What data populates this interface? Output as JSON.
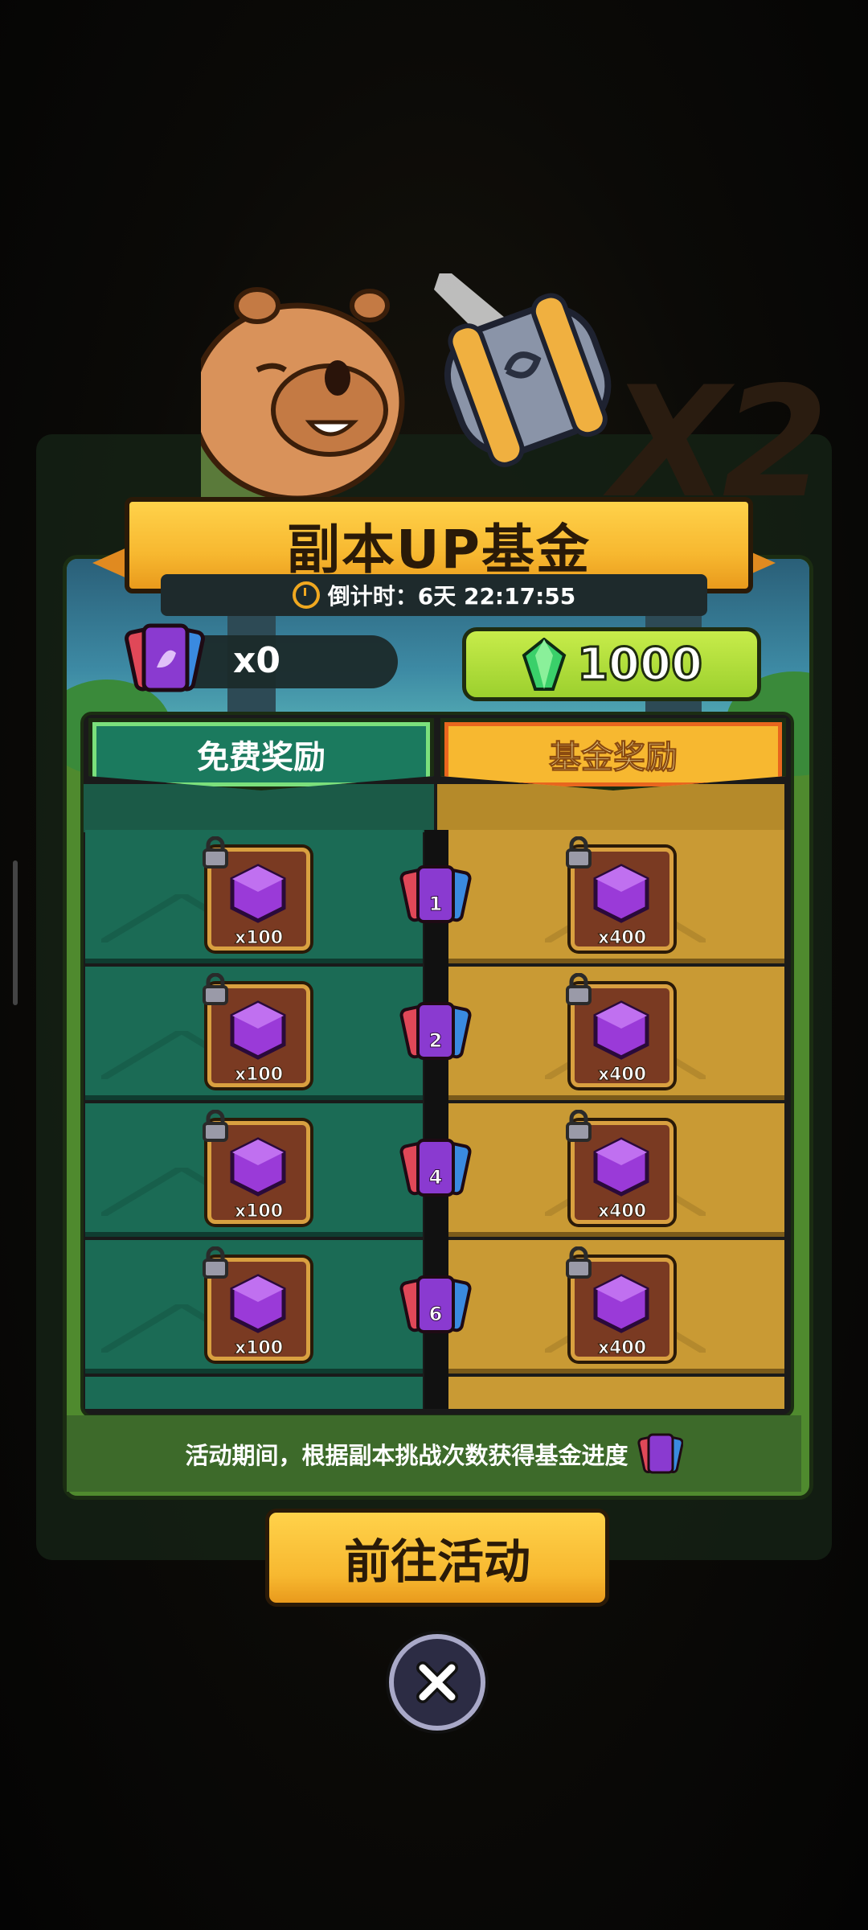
{
  "popup": {
    "title": "副本UP基金",
    "countdown": "倒计时：6天 22:17:55",
    "ticket_count": "x0",
    "gem_value": "1000"
  },
  "tabs": {
    "free": "免费奖励",
    "fund": "基金奖励"
  },
  "rows": [
    {
      "milestone": "1",
      "free_qty": "x100",
      "fund_qty": "x400"
    },
    {
      "milestone": "2",
      "free_qty": "x100",
      "fund_qty": "x400"
    },
    {
      "milestone": "4",
      "free_qty": "x100",
      "fund_qty": "x400"
    },
    {
      "milestone": "6",
      "free_qty": "x100",
      "fund_qty": "x400"
    }
  ],
  "footer": {
    "hint": "活动期间，根据副本挑战次数获得基金进度"
  },
  "buttons": {
    "go": "前往活动"
  },
  "colors": {
    "accent_yellow": "#f7b830",
    "free_green": "#1b6b55",
    "fund_gold": "#c99a34",
    "gem_green": "#9cd02e"
  },
  "icons": [
    "stopwatch-icon",
    "ticket-icon",
    "gem-icon",
    "lock-icon",
    "purple-cube-icon",
    "close-icon"
  ]
}
